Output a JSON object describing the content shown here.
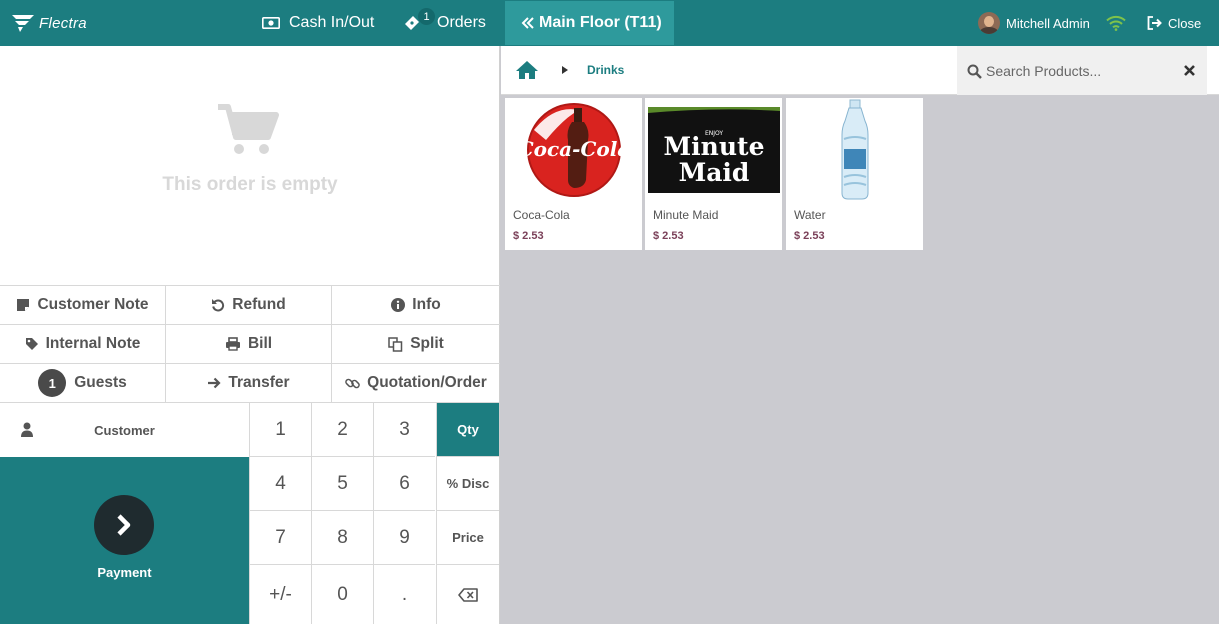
{
  "header": {
    "logo_text": "Flectra",
    "cash_label": "Cash In/Out",
    "orders_label": "Orders",
    "orders_count": "1",
    "floor_label": "Main Floor (T11)",
    "user_name": "Mitchell Admin",
    "close_label": "Close",
    "accent": "#1c7d80"
  },
  "order": {
    "empty_text": "This order is empty"
  },
  "controls": {
    "customer_note": "Customer Note",
    "refund": "Refund",
    "info": "Info",
    "internal_note": "Internal Note",
    "bill": "Bill",
    "split": "Split",
    "guests_count": "1",
    "guests": "Guests",
    "transfer": "Transfer",
    "quotation": "Quotation/Order"
  },
  "actionpad": {
    "customer": "Customer",
    "payment": "Payment"
  },
  "numpad": {
    "k1": "1",
    "k2": "2",
    "k3": "3",
    "qty": "Qty",
    "k4": "4",
    "k5": "5",
    "k6": "6",
    "disc": "% Disc",
    "k7": "7",
    "k8": "8",
    "k9": "9",
    "price": "Price",
    "sign": "+/-",
    "k0": "0",
    "dot": ".",
    "active_mode": "Qty"
  },
  "breadcrumb": {
    "category": "Drinks"
  },
  "search": {
    "placeholder": "Search Products..."
  },
  "products": [
    {
      "name": "Coca-Cola",
      "price": "$ 2.53",
      "image": "coca-cola-logo"
    },
    {
      "name": "Minute Maid",
      "price": "$ 2.53",
      "image": "minute-maid-logo"
    },
    {
      "name": "Water",
      "price": "$ 2.53",
      "image": "water-bottle"
    }
  ]
}
